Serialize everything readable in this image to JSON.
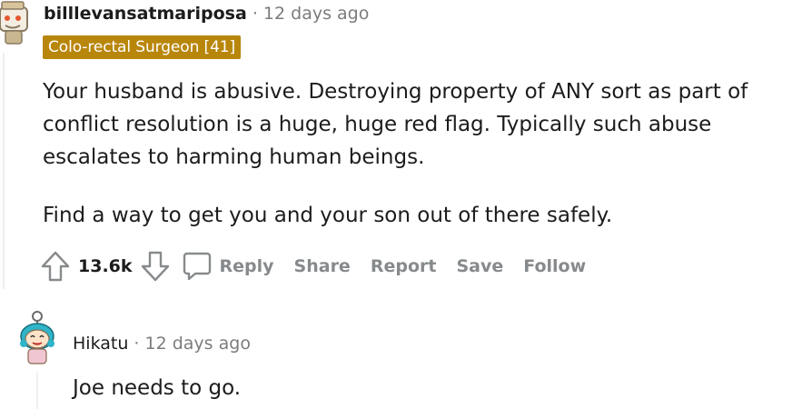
{
  "comments": [
    {
      "username": "billlevansatmariposa",
      "separator": "·",
      "time": "12 days ago",
      "flair": "Colo-rectal Surgeon [41]",
      "paragraphs": [
        "Your husband is abusive. Destroying property of ANY sort as part of conflict resolution is a huge, huge red flag. Typically such abuse escalates to harming human beings.",
        "Find a way to get you and your son out of there safely."
      ],
      "score": "13.6k",
      "actions": {
        "reply": "Reply",
        "share": "Share",
        "report": "Report",
        "save": "Save",
        "follow": "Follow"
      }
    },
    {
      "username": "Hikatu",
      "separator": "·",
      "time": "12 days ago",
      "paragraphs": [
        "Joe needs to go."
      ]
    }
  ],
  "colors": {
    "flair_bg": "#b8860b",
    "action_gray": "#878a8c",
    "meta_gray": "#7c7c7c",
    "text": "#1c1c1c"
  },
  "icons": [
    "upvote-icon",
    "downvote-icon",
    "comment-icon"
  ]
}
